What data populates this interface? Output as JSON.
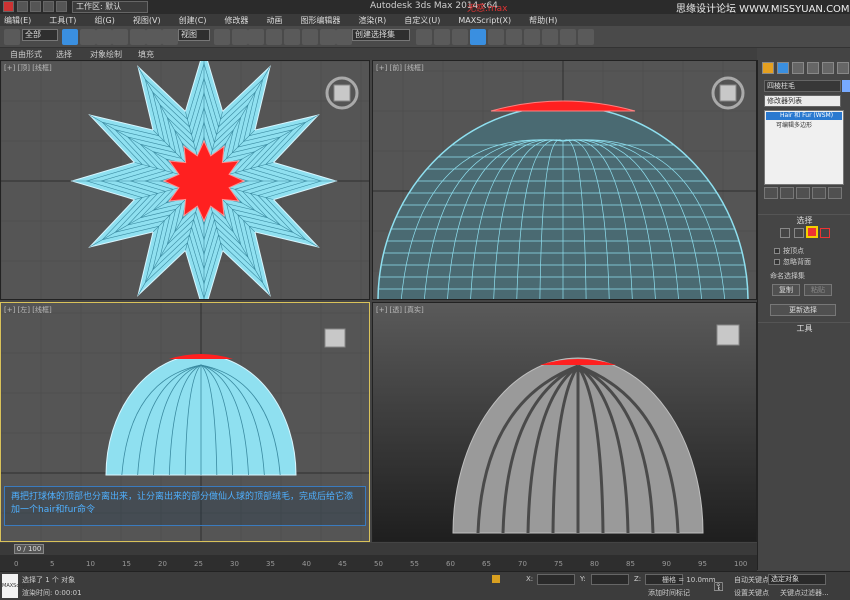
{
  "title_bar": {
    "workspace": "工作区: 默认",
    "app_title": "Autodesk 3ds Max  2014 x64",
    "file_name": "无惑.max",
    "watermark": "思缘设计论坛  WWW.MISSYUAN.COM"
  },
  "menu": [
    "编辑(E)",
    "工具(T)",
    "组(G)",
    "视图(V)",
    "创建(C)",
    "修改器",
    "动画",
    "图形编辑器",
    "渲染(R)",
    "自定义(U)",
    "MAXScript(X)",
    "帮助(H)"
  ],
  "toolbar": {
    "selection_filter": "全部",
    "reference_coord": "视图",
    "named_selection": "创建选择集"
  },
  "ribbon": [
    "自由形式",
    "选择",
    "对象绘制",
    "填充"
  ],
  "viewports": {
    "top": {
      "label": "[+] [顶] [线框]"
    },
    "front": {
      "label": "[+] [前] [线框]"
    },
    "left": {
      "label": "[+] [左] [线框]"
    },
    "perspective": {
      "label": "[+] [透] [真实]"
    }
  },
  "command_panel": {
    "object_name": "四棱柱毛",
    "modifier_list": "修改器列表",
    "stack": [
      "Hair 和 Fur (WSM)",
      "可编辑多边形"
    ],
    "selection_title": "选择",
    "by_vertex": "按顶点",
    "ignore_backface": "忽略背面",
    "named_selection_sets": "命名选择集",
    "copy": "复制",
    "paste": "粘贴",
    "update_selection": "更新选择",
    "tools_title": "工具"
  },
  "annotation": "再把打球体的顶部也分离出来，让分离出来的部分做仙人球的顶部绒毛，完成后给它添加一个hair和fur命令",
  "timeline": {
    "frame_display": "0 / 100",
    "ticks": [
      "0",
      "5",
      "10",
      "15",
      "20",
      "25",
      "30",
      "35",
      "40",
      "45",
      "50",
      "55",
      "60",
      "65",
      "70",
      "75",
      "80",
      "85",
      "90",
      "95",
      "100"
    ]
  },
  "status_bar": {
    "script_label": "MAXScript",
    "selected_text": "选择了 1 个 对象",
    "render_time": "渲染时间: 0:00:01",
    "x_label": "X:",
    "y_label": "Y:",
    "z_label": "Z:",
    "grid": "栅格 = 10.0mm",
    "add_time_tag": "添加时间标记",
    "auto_key": "自动关键点",
    "selected_objects": "选定对象",
    "set_key": "设置关键点",
    "key_filters": "关键点过滤器..."
  },
  "colors": {
    "wire_cyan": "#8fe0f0",
    "top_red": "#ff2020",
    "viewport_bg": "#555555",
    "annotation_text": "#4fb0ff"
  }
}
